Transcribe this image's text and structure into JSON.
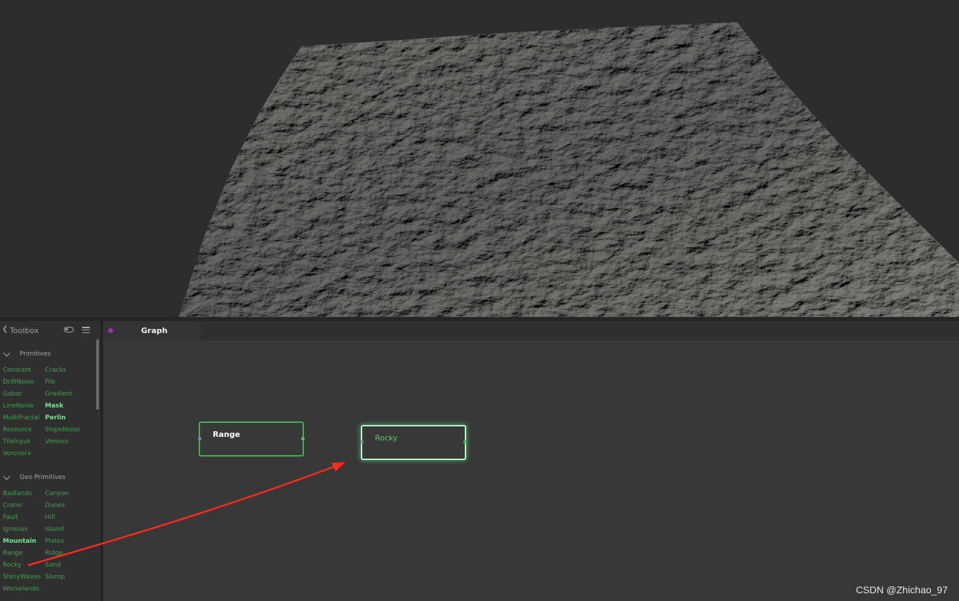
{
  "toolbox": {
    "title": "Toolbox",
    "sections": [
      {
        "title": "Primitives",
        "items": [
          {
            "label": "Constant"
          },
          {
            "label": "Cracks"
          },
          {
            "label": "DriftNoise"
          },
          {
            "label": "File"
          },
          {
            "label": "Gabor"
          },
          {
            "label": "Gradient"
          },
          {
            "label": "LineNoise"
          },
          {
            "label": "Mask",
            "highlight": true
          },
          {
            "label": "MultiFractal"
          },
          {
            "label": "Perlin",
            "highlight": true
          },
          {
            "label": "Resource"
          },
          {
            "label": "SlopeNoise"
          },
          {
            "label": "TileInput"
          },
          {
            "label": "Voronoi"
          },
          {
            "label": "Voronoi+"
          }
        ]
      },
      {
        "title": "Geo Primitives",
        "items": [
          {
            "label": "Badlands"
          },
          {
            "label": "Canyon"
          },
          {
            "label": "Crater"
          },
          {
            "label": "Dunes"
          },
          {
            "label": "Fault"
          },
          {
            "label": "Hill"
          },
          {
            "label": "Igneous"
          },
          {
            "label": "Island"
          },
          {
            "label": "Mountain",
            "highlight": true
          },
          {
            "label": "Plates"
          },
          {
            "label": "Range"
          },
          {
            "label": "Ridge"
          },
          {
            "label": "Rocky"
          },
          {
            "label": "Sand"
          },
          {
            "label": "ShinyWaves"
          },
          {
            "label": "Slump"
          },
          {
            "label": "Worselands"
          }
        ]
      }
    ]
  },
  "graph": {
    "tab_label": "Graph",
    "nodes": {
      "range": {
        "title": "Range"
      },
      "rocky": {
        "title": "Rocky"
      }
    }
  },
  "colors": {
    "tool_item": "#3fa34d",
    "tool_item_highlight": "#6fe88a",
    "node_border": "#49ad58",
    "node_selected_border": "#b8f5d0",
    "arrow": "#ff2a1e",
    "graph_tab_dot": "#9b2fae"
  },
  "watermark": "CSDN @Zhichao_97"
}
